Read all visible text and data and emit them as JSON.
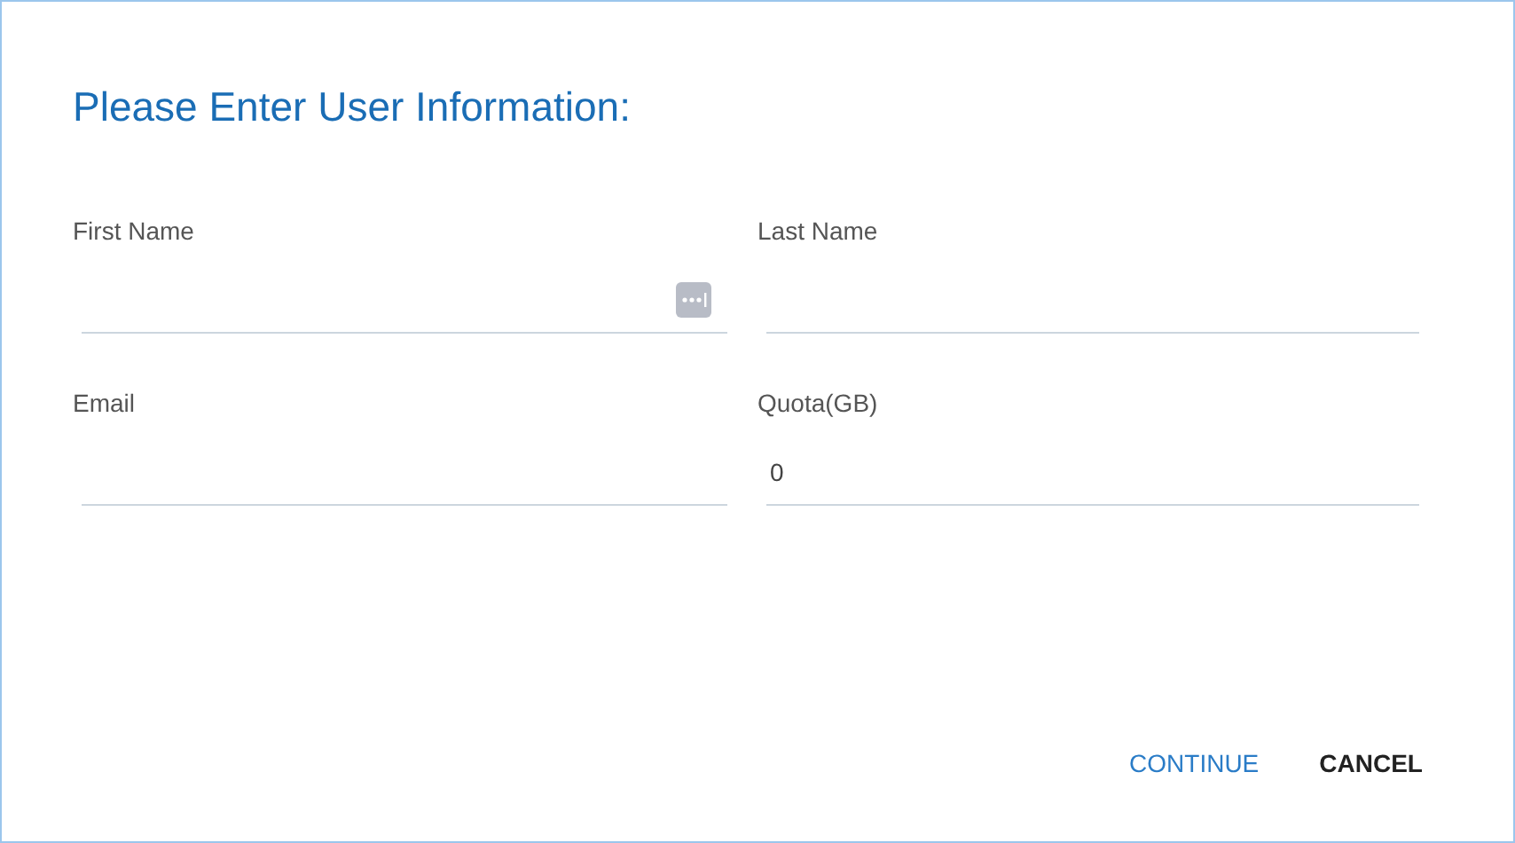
{
  "dialog": {
    "title": "Please Enter User Information:",
    "fields": [
      {
        "label": "First Name",
        "autofill_icon": true
      },
      {
        "label": "Last Name"
      },
      {
        "label": "Email"
      },
      {
        "label": "Quota(GB)",
        "value": "0"
      }
    ],
    "buttons": [
      {
        "label": "CONTINUE",
        "kind": "primary"
      },
      {
        "label": "CANCEL",
        "kind": "default"
      }
    ]
  }
}
